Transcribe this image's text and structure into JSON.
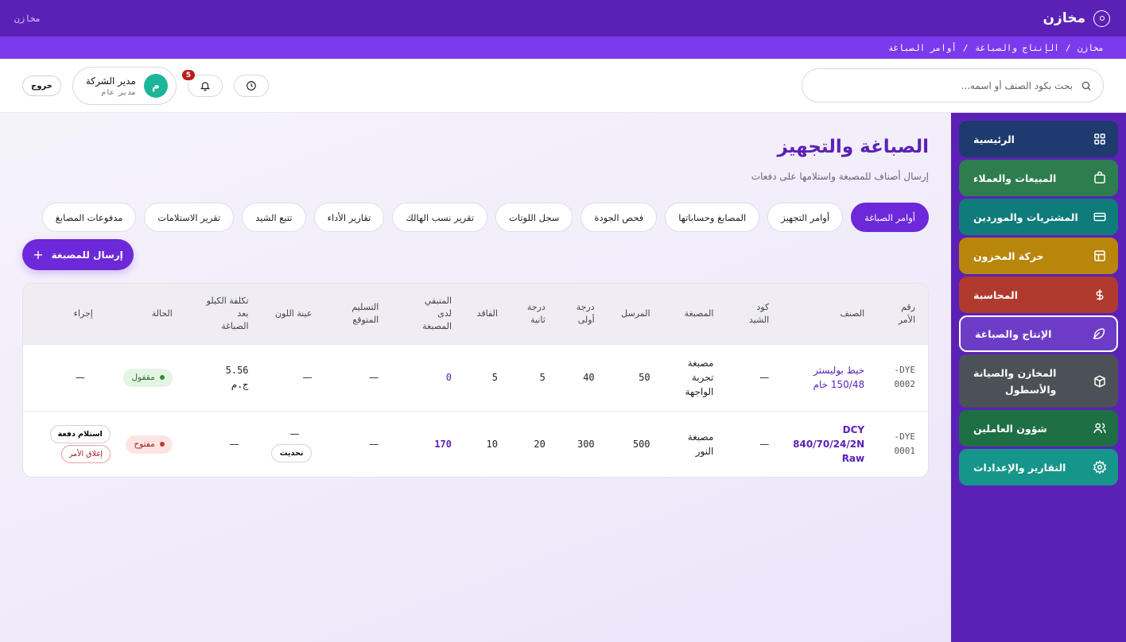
{
  "app": {
    "name": "مخازن",
    "topbar_left": "مخازن"
  },
  "breadcrumb": [
    "مخازن",
    "الإنتاج والصباغة",
    "أوامر الصباغة"
  ],
  "search": {
    "placeholder": "بحث بكود الصنف أو اسمه..."
  },
  "header": {
    "logout_label": "خروج",
    "user_name": "مدير الشركة",
    "user_role": "مدير عام",
    "avatar_letter": "م",
    "notifications_count": "5"
  },
  "page": {
    "title": "الصباغة والتجهيز",
    "subtitle": "إرسال أصناف للمصبغة واستلامها على دفعات",
    "send_button": "إرسال للمصبغة"
  },
  "tabs": [
    {
      "label": "أوامر الصباغة",
      "active": true
    },
    {
      "label": "أوامر التجهيز",
      "active": false
    },
    {
      "label": "المصابغ وحساباتها",
      "active": false
    },
    {
      "label": "فحص الجودة",
      "active": false
    },
    {
      "label": "سجل اللوتات",
      "active": false
    },
    {
      "label": "تقرير نسب الهالك",
      "active": false
    },
    {
      "label": "تقارير الأداء",
      "active": false
    },
    {
      "label": "تتبع الشيد",
      "active": false
    },
    {
      "label": "تقرير الاستلامات",
      "active": false
    },
    {
      "label": "مدفوعات المصابغ",
      "active": false
    }
  ],
  "table": {
    "headers": {
      "order_no": [
        "رقم",
        "الأمر"
      ],
      "item": "الصنف",
      "shade_code": [
        "كود",
        "الشيد"
      ],
      "dyehouse": "المصبغة",
      "sent": "المرسل",
      "grade1": [
        "درجة",
        "أولى"
      ],
      "grade2": [
        "درجة",
        "ثانية"
      ],
      "lost": "الفاقد",
      "remaining": [
        "المتبقي",
        "لدى",
        "المصبغة"
      ],
      "delivery": [
        "التسليم",
        "المتوقع"
      ],
      "color_sample": "عينة اللون",
      "cost": [
        "تكلفة الكيلو",
        "بعد",
        "الصباغة"
      ],
      "status": "الحالة",
      "action": "إجراء"
    },
    "rows": [
      {
        "order_no": [
          "DYE-",
          "0002"
        ],
        "item": [
          "خيط بوليستر",
          "150/48 خام"
        ],
        "shade_code": "—",
        "dyehouse": [
          "مصبغة",
          "تجربة",
          "الواجهة"
        ],
        "sent": "50",
        "grade1": "40",
        "grade2": "5",
        "lost": "5",
        "remaining": "0",
        "delivery": "—",
        "color_sample": "—",
        "cost": [
          "5.56",
          "ج.م"
        ],
        "status": "مقفول",
        "action": "—"
      },
      {
        "order_no": [
          "DYE-",
          "0001"
        ],
        "item": [
          "DCY",
          "840/70/24/2N",
          "Raw"
        ],
        "shade_code": "—",
        "dyehouse": [
          "مصبغة",
          "النور"
        ],
        "sent": "500",
        "grade1": "300",
        "grade2": "20",
        "lost": "10",
        "remaining": "170",
        "delivery": "—",
        "color_sample": "—",
        "color_sample_button": "تحديث",
        "cost": "—",
        "status": "مفتوح",
        "actions": [
          "استلام دفعة",
          "إغلاق الأمر"
        ]
      }
    ]
  },
  "sidebar": {
    "items": [
      {
        "label": "الرئيسية",
        "icon": "grid-icon",
        "color": "#1e3a6e"
      },
      {
        "label": "المبيعات والعملاء",
        "icon": "bag-icon",
        "color": "#2e7d4f"
      },
      {
        "label": "المشتريات والموردين",
        "icon": "card-icon",
        "color": "#0f7b7b"
      },
      {
        "label": "حركة المخزون",
        "icon": "table-icon",
        "color": "#b8860b"
      },
      {
        "label": "المحاسبة",
        "icon": "dollar-icon",
        "color": "#b03a2e"
      },
      {
        "label": "الإنتاج والصباغة",
        "icon": "feather-icon",
        "color": "#6d3cc7",
        "active": true
      },
      {
        "label": "المخازن والصيانة",
        "label2": "والأسطول",
        "icon": "box-icon",
        "color": "#4b5157"
      },
      {
        "label": "شؤون العاملين",
        "icon": "users-icon",
        "color": "#1f6f45"
      },
      {
        "label": "التقارير والإعدادات",
        "icon": "gear-icon",
        "color": "#16968a"
      }
    ]
  }
}
